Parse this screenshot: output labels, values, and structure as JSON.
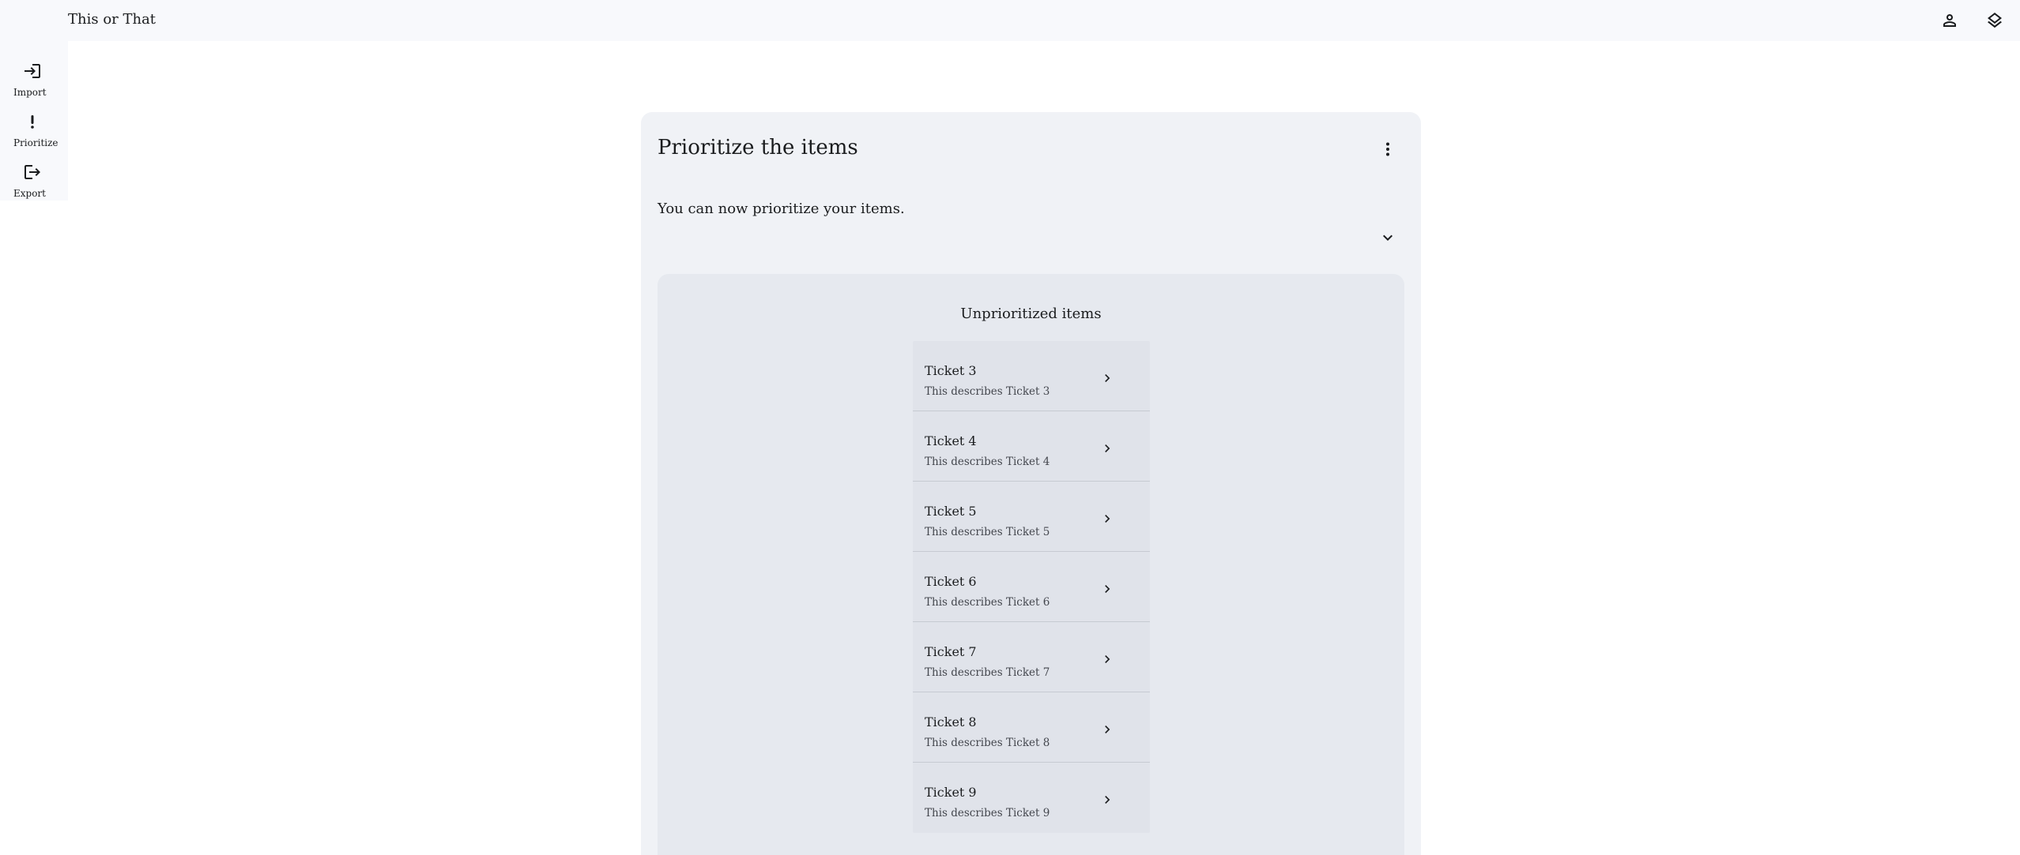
{
  "app": {
    "title": "This or That"
  },
  "topbar": {
    "icons": [
      "person-icon",
      "layers-icon"
    ]
  },
  "nav": {
    "items": [
      {
        "label": "Import",
        "icon": "login-icon"
      },
      {
        "label": "Prioritize",
        "icon": "priority-icon"
      },
      {
        "label": "Export",
        "icon": "logout-icon"
      }
    ]
  },
  "card": {
    "title": "Prioritize the items",
    "description": "You can now prioritize your items."
  },
  "list": {
    "title": "Unprioritized items",
    "items": [
      {
        "title": "Ticket 3",
        "subtitle": "This describes Ticket 3"
      },
      {
        "title": "Ticket 4",
        "subtitle": "This describes Ticket 4"
      },
      {
        "title": "Ticket 5",
        "subtitle": "This describes Ticket 5"
      },
      {
        "title": "Ticket 6",
        "subtitle": "This describes Ticket 6"
      },
      {
        "title": "Ticket 7",
        "subtitle": "This describes Ticket 7"
      },
      {
        "title": "Ticket 8",
        "subtitle": "This describes Ticket 8"
      },
      {
        "title": "Ticket 9",
        "subtitle": "This describes Ticket 9"
      }
    ]
  },
  "colors": {
    "background": "#ffffff",
    "surface": "#f8f9fc",
    "card": "#f0f2f6",
    "inner_panel": "#e6e9ef",
    "list_bg": "#e0e3ea",
    "text": "#1a1c1e"
  }
}
